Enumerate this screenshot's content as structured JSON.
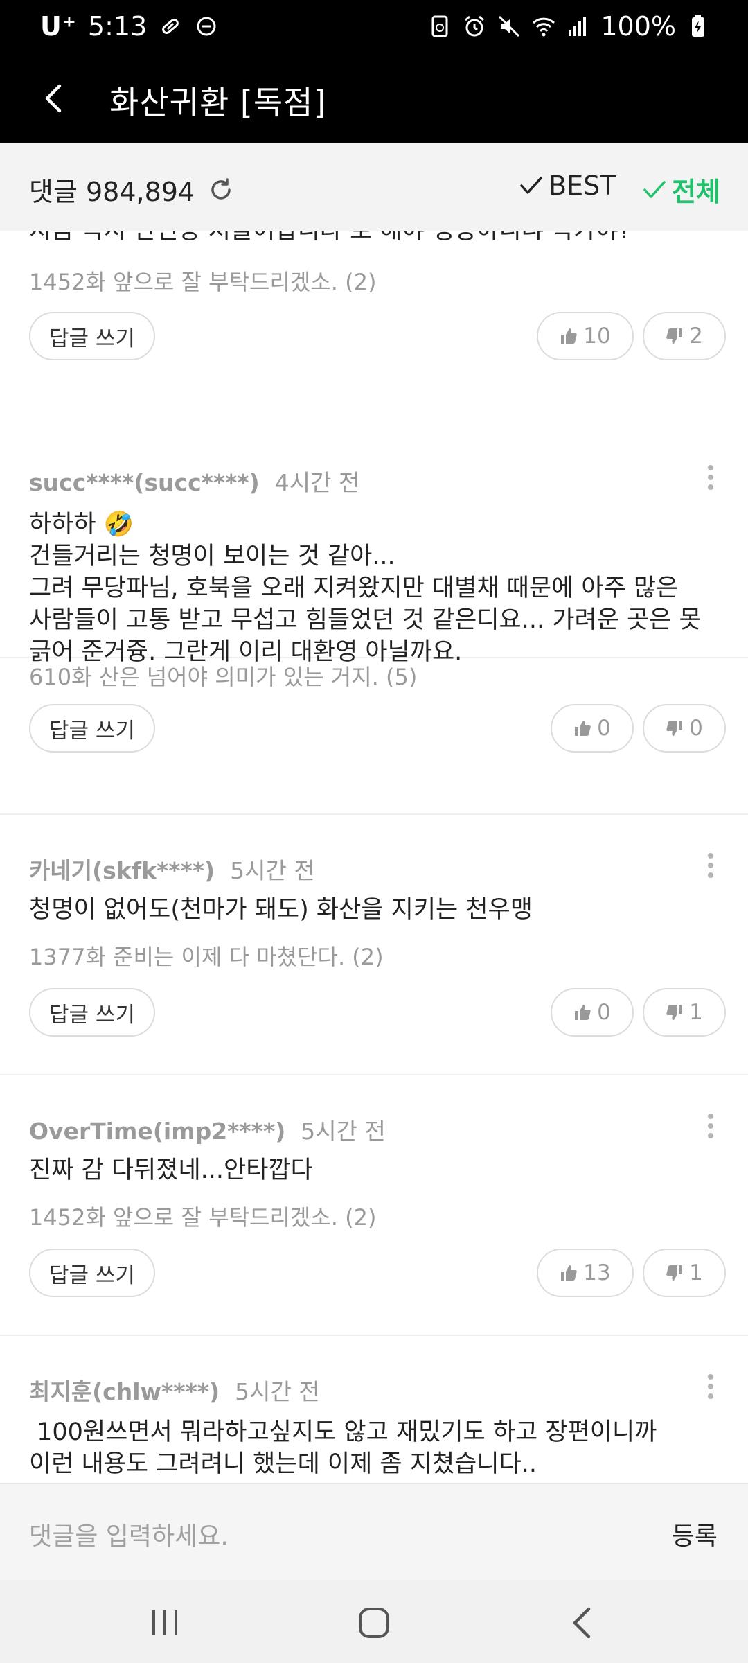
{
  "status_bar": {
    "carrier": "U⁺",
    "time": "5:13",
    "battery": "100%"
  },
  "header": {
    "title": "화산귀환 [독점]"
  },
  "comment_bar": {
    "count_label": "댓글 984,894",
    "sort_best": "BEST",
    "sort_all": "전체",
    "active_color": "#1fc26b"
  },
  "comments": [
    {
      "author": "",
      "time": "",
      "body": "",
      "partial_line": "지금 즉시 만인방 처들어갑니다 로 해야 정상아니냐 작가야?",
      "ref": "1452화 앞으로 잘 부탁드리겠소. (2)",
      "reply_label": "답글 쓰기",
      "likes": "10",
      "dislikes": "2"
    },
    {
      "author": "succ****(succ****)",
      "time": "4시간 전",
      "body": "하하하 🤣\n건들거리는 청명이 보이는 것 같아...\n그려 무당파님, 호북을 오래 지켜왔지만 대별채 때문에 아주 많은\n사람들이 고통 받고 무섭고 힘들었던 것 같은디요... 가려운 곳은 못\n긁어 준거즁. 그란게 이리 대환영 아닐까요.",
      "ref": "610화 산은 넘어야 의미가 있는 거지. (5)",
      "reply_label": "답글 쓰기",
      "likes": "0",
      "dislikes": "0"
    },
    {
      "author": "카네기(skfk****)",
      "time": "5시간 전",
      "body": "청명이 없어도(천마가 돼도) 화산을 지키는 천우맹",
      "ref": "1377화 준비는 이제 다 마쳤단다. (2)",
      "reply_label": "답글 쓰기",
      "likes": "0",
      "dislikes": "1"
    },
    {
      "author": "OverTime(imp2****)",
      "time": "5시간 전",
      "body": "진짜 감 다뒤졌네...안타깝다",
      "ref": "1452화 앞으로 잘 부탁드리겠소. (2)",
      "reply_label": "답글 쓰기",
      "likes": "13",
      "dislikes": "1"
    },
    {
      "author": "최지훈(chlw****)",
      "time": "5시간 전",
      "body": " 100원쓰면서 뭐라하고싶지도 않고 재밌기도 하고 장편이니까\n이런 내용도 그려려니 했는데 이제 좀 지쳤습니다.."
    }
  ],
  "input": {
    "placeholder": "댓글을 입력하세요.",
    "submit_label": "등록"
  }
}
